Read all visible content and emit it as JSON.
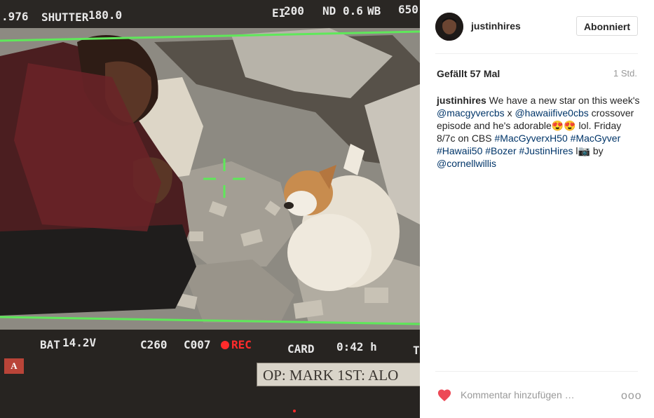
{
  "viewfinder": {
    "top_left": ".976",
    "shutter_label": "SHUTTER",
    "shutter_value": "180.0",
    "ei_label": "EI",
    "ei_value": "200",
    "nd_label": "ND",
    "nd_value": "0.6",
    "wb_label": "WB",
    "wb_value": "650",
    "bat_label": "BAT",
    "bat_value": "14.2V",
    "clip_c": "C260",
    "clip_code": "C007",
    "rec_label": "REC",
    "card_label": "CARD",
    "card_value": "0:42 h",
    "edge_right": "T",
    "red_marker": "A",
    "tape_text": "OP: MARK 1ST: ALO"
  },
  "post": {
    "username": "justinhires",
    "follow_button": "Abonniert",
    "likes": "Gefällt 57 Mal",
    "time": "1 Std.",
    "caption_user": "justinhires",
    "caption_t1": " We have a new star on this week's ",
    "mention1": "@macgyvercbs",
    "caption_t2": " x ",
    "mention2": "@hawaiifive0cbs",
    "caption_t3": " crossover episode and he's adorable😍😍 lol. Friday 8/7c on CBS ",
    "tag1": "#MacGyverxH50",
    "tag2": "#MacGyver",
    "tag3": "#Hawaii50",
    "tag4": "#Bozer",
    "tag5": "#JustinHires",
    "caption_t4": " l📷 by ",
    "mention3": "@cornellwillis",
    "comment_placeholder": "Kommentar hinzufügen …",
    "more_label": "ooo"
  },
  "icons": {
    "heart": "heart-icon",
    "more": "more-options-icon",
    "avatar": "avatar"
  },
  "colors": {
    "like_red": "#ed4956",
    "link_blue": "#003569",
    "frame_green": "#5fe85a"
  }
}
